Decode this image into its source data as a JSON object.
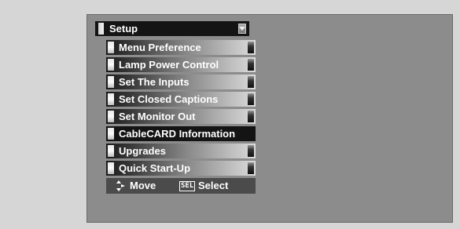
{
  "menu": {
    "title": "Setup",
    "items": [
      {
        "label": "Menu Preference",
        "selected": false
      },
      {
        "label": "Lamp Power Control",
        "selected": false
      },
      {
        "label": "Set The Inputs",
        "selected": false
      },
      {
        "label": "Set Closed Captions",
        "selected": false
      },
      {
        "label": "Set Monitor Out",
        "selected": false
      },
      {
        "label": "CableCARD Information",
        "selected": true
      },
      {
        "label": "Upgrades",
        "selected": false
      },
      {
        "label": "Quick Start-Up",
        "selected": false
      }
    ]
  },
  "footer": {
    "move_label": "Move",
    "sel_key": "SEL",
    "select_label": "Select"
  },
  "colors": {
    "page_background": "#d6d6d6",
    "screen_background": "#8c8c8c",
    "selected_item": "#141414",
    "footer_background": "#4b4b4b"
  },
  "icons": {
    "dropdown": "chevron-down-icon",
    "move": "updown-arrows-icon"
  }
}
